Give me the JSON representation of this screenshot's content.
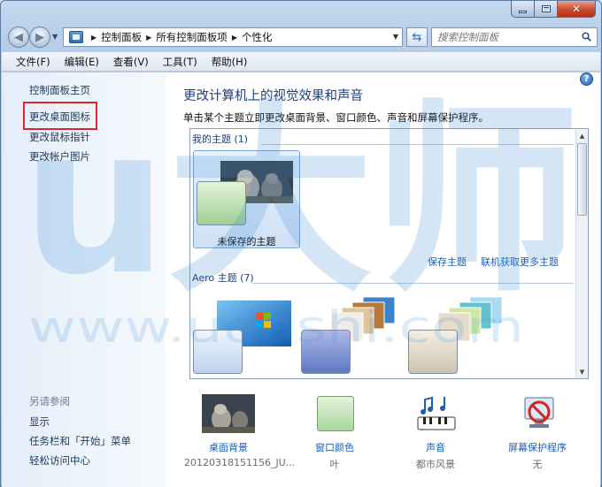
{
  "address": {
    "crumbs": [
      "控制面板",
      "所有控制面板项",
      "个性化"
    ]
  },
  "search": {
    "placeholder": "搜索控制面板"
  },
  "menu": [
    "文件(F)",
    "编辑(E)",
    "查看(V)",
    "工具(T)",
    "帮助(H)"
  ],
  "sidebar": {
    "links": [
      "控制面板主页",
      "更改桌面图标",
      "更改鼠标指针",
      "更改帐户图片"
    ],
    "see_also_caption": "另请参阅",
    "see_also": [
      "显示",
      "任务栏和「开始」菜单",
      "轻松访问中心"
    ]
  },
  "main": {
    "title": "更改计算机上的视觉效果和声音",
    "subtitle": "单击某个主题立即更改桌面背景、窗口颜色、声音和屏幕保护程序。",
    "my_themes_header": "我的主题 (1)",
    "unsaved_theme_label": "未保存的主题",
    "save_theme": "保存主题",
    "get_more_themes": "联机获取更多主题",
    "aero_header": "Aero 主题 (7)"
  },
  "bottom": {
    "desktop_background": {
      "label": "桌面背景",
      "value": "20120318151156_JU..."
    },
    "window_color": {
      "label": "窗口颜色",
      "value": "叶"
    },
    "sounds": {
      "label": "声音",
      "value": "都市风景"
    },
    "screen_saver": {
      "label": "屏幕保护程序",
      "value": "无"
    }
  },
  "watermark_text": "u大师",
  "watermark_url": "www.udashi.com",
  "colors": {
    "highlight_box": "#e0262b",
    "link": "#1a5fb4",
    "title": "#1e3f7a",
    "window_color_tile": "#bfe0b4"
  }
}
